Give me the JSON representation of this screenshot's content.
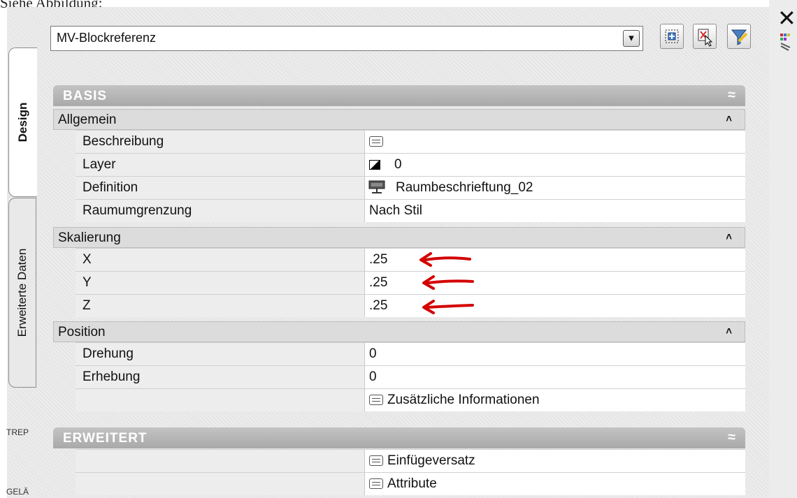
{
  "page_caption": "Siehe Abbildung:",
  "window": {
    "close_glyph": "✕"
  },
  "tabs": {
    "design": "Design",
    "extended": "Erweiterte Daten"
  },
  "side_fragments": {
    "trep": "TREP",
    "gel": "GELÄ"
  },
  "object_select": {
    "value": "MV-Blockreferenz",
    "arrow_glyph": "▾"
  },
  "sections": {
    "basis": {
      "title": "BASIS",
      "collapse_glyph": "≈",
      "categories": [
        {
          "name": "Allgemein",
          "chevron": "˄",
          "rows": [
            {
              "label": "Beschreibung",
              "value": ""
            },
            {
              "label": "Layer",
              "value": "0"
            },
            {
              "label": "Definition",
              "value": "Raumbeschrieftung_02"
            },
            {
              "label": "Raumumgrenzung",
              "value": "Nach Stil"
            }
          ]
        },
        {
          "name": "Skalierung",
          "chevron": "˄",
          "rows": [
            {
              "label": "X",
              "value": ".25"
            },
            {
              "label": "Y",
              "value": ".25"
            },
            {
              "label": "Z",
              "value": ".25"
            }
          ]
        },
        {
          "name": "Position",
          "chevron": "˄",
          "rows": [
            {
              "label": "Drehung",
              "value": "0"
            },
            {
              "label": "Erhebung",
              "value": "0"
            },
            {
              "label": "",
              "value": "Zusätzliche Informationen"
            }
          ]
        }
      ]
    },
    "erweitert": {
      "title": "ERWEITERT",
      "collapse_glyph": "≈",
      "rows": [
        {
          "label": "",
          "value": "Einfügeversatz"
        },
        {
          "label": "",
          "value": "Attribute"
        }
      ]
    }
  },
  "colors": {
    "annotation_arrow": "#d40000",
    "section_header": "#b4b4b4",
    "category_bg": "#dcdcdc"
  }
}
